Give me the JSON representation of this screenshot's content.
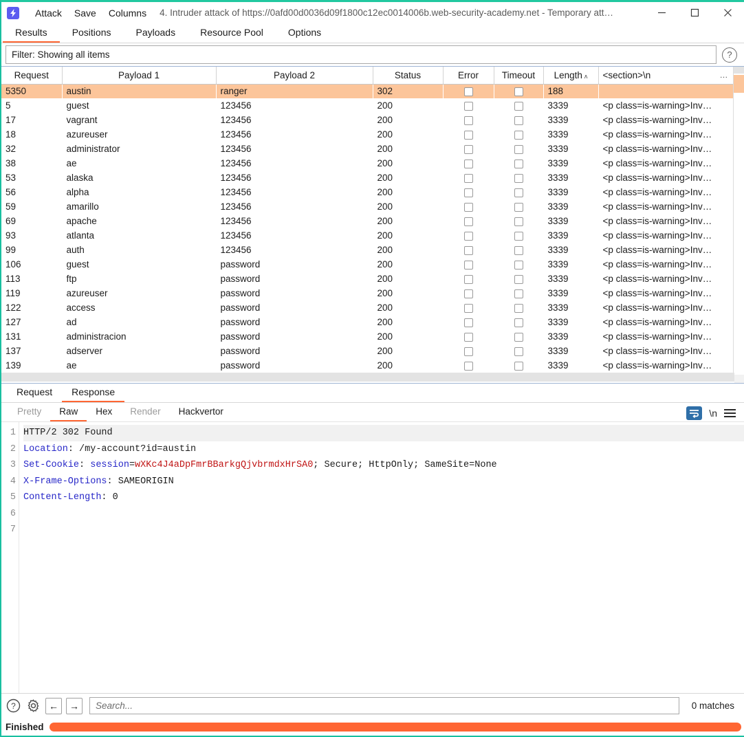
{
  "window": {
    "logo_glyph": "⚡",
    "menus": [
      "Attack",
      "Save",
      "Columns"
    ],
    "title": "4. Intruder attack of https://0afd00d0036d09f1800c12ec0014006b.web-security-academy.net - Temporary att…",
    "buttons": {
      "minimize": "minimize-button",
      "maximize": "maximize-button",
      "close": "close-button"
    }
  },
  "main_tabs": [
    {
      "label": "Results",
      "active": true
    },
    {
      "label": "Positions",
      "active": false
    },
    {
      "label": "Payloads",
      "active": false
    },
    {
      "label": "Resource Pool",
      "active": false
    },
    {
      "label": "Options",
      "active": false
    }
  ],
  "filter": {
    "text": "Filter: Showing all items",
    "help": "?"
  },
  "results_table": {
    "columns": [
      "Request",
      "Payload 1",
      "Payload 2",
      "Status",
      "Error",
      "Timeout",
      "Length",
      "<section>\\n",
      "…"
    ],
    "sorted_column": "Length",
    "sort_arrow": "ʌ",
    "overflow_dots": "…",
    "rows": [
      {
        "request": "5350",
        "payload1": "austin",
        "payload2": "ranger",
        "status": "302",
        "error": false,
        "timeout": false,
        "length": "188",
        "section": "",
        "highlight": true
      },
      {
        "request": "5",
        "payload1": "guest",
        "payload2": "123456",
        "status": "200",
        "error": false,
        "timeout": false,
        "length": "3339",
        "section": "<p class=is-warning>Inv…",
        "highlight": false
      },
      {
        "request": "17",
        "payload1": "vagrant",
        "payload2": "123456",
        "status": "200",
        "error": false,
        "timeout": false,
        "length": "3339",
        "section": "<p class=is-warning>Inv…",
        "highlight": false
      },
      {
        "request": "18",
        "payload1": "azureuser",
        "payload2": "123456",
        "status": "200",
        "error": false,
        "timeout": false,
        "length": "3339",
        "section": "<p class=is-warning>Inv…",
        "highlight": false
      },
      {
        "request": "32",
        "payload1": "administrator",
        "payload2": "123456",
        "status": "200",
        "error": false,
        "timeout": false,
        "length": "3339",
        "section": "<p class=is-warning>Inv…",
        "highlight": false
      },
      {
        "request": "38",
        "payload1": "ae",
        "payload2": "123456",
        "status": "200",
        "error": false,
        "timeout": false,
        "length": "3339",
        "section": "<p class=is-warning>Inv…",
        "highlight": false
      },
      {
        "request": "53",
        "payload1": "alaska",
        "payload2": "123456",
        "status": "200",
        "error": false,
        "timeout": false,
        "length": "3339",
        "section": "<p class=is-warning>Inv…",
        "highlight": false
      },
      {
        "request": "56",
        "payload1": "alpha",
        "payload2": "123456",
        "status": "200",
        "error": false,
        "timeout": false,
        "length": "3339",
        "section": "<p class=is-warning>Inv…",
        "highlight": false
      },
      {
        "request": "59",
        "payload1": "amarillo",
        "payload2": "123456",
        "status": "200",
        "error": false,
        "timeout": false,
        "length": "3339",
        "section": "<p class=is-warning>Inv…",
        "highlight": false
      },
      {
        "request": "69",
        "payload1": "apache",
        "payload2": "123456",
        "status": "200",
        "error": false,
        "timeout": false,
        "length": "3339",
        "section": "<p class=is-warning>Inv…",
        "highlight": false
      },
      {
        "request": "93",
        "payload1": "atlanta",
        "payload2": "123456",
        "status": "200",
        "error": false,
        "timeout": false,
        "length": "3339",
        "section": "<p class=is-warning>Inv…",
        "highlight": false
      },
      {
        "request": "99",
        "payload1": "auth",
        "payload2": "123456",
        "status": "200",
        "error": false,
        "timeout": false,
        "length": "3339",
        "section": "<p class=is-warning>Inv…",
        "highlight": false
      },
      {
        "request": "106",
        "payload1": "guest",
        "payload2": "password",
        "status": "200",
        "error": false,
        "timeout": false,
        "length": "3339",
        "section": "<p class=is-warning>Inv…",
        "highlight": false
      },
      {
        "request": "113",
        "payload1": "ftp",
        "payload2": "password",
        "status": "200",
        "error": false,
        "timeout": false,
        "length": "3339",
        "section": "<p class=is-warning>Inv…",
        "highlight": false
      },
      {
        "request": "119",
        "payload1": "azureuser",
        "payload2": "password",
        "status": "200",
        "error": false,
        "timeout": false,
        "length": "3339",
        "section": "<p class=is-warning>Inv…",
        "highlight": false
      },
      {
        "request": "122",
        "payload1": "access",
        "payload2": "password",
        "status": "200",
        "error": false,
        "timeout": false,
        "length": "3339",
        "section": "<p class=is-warning>Inv…",
        "highlight": false
      },
      {
        "request": "127",
        "payload1": "ad",
        "payload2": "password",
        "status": "200",
        "error": false,
        "timeout": false,
        "length": "3339",
        "section": "<p class=is-warning>Inv…",
        "highlight": false
      },
      {
        "request": "131",
        "payload1": "administracion",
        "payload2": "password",
        "status": "200",
        "error": false,
        "timeout": false,
        "length": "3339",
        "section": "<p class=is-warning>Inv…",
        "highlight": false
      },
      {
        "request": "137",
        "payload1": "adserver",
        "payload2": "password",
        "status": "200",
        "error": false,
        "timeout": false,
        "length": "3339",
        "section": "<p class=is-warning>Inv…",
        "highlight": false
      },
      {
        "request": "139",
        "payload1": "ae",
        "payload2": "password",
        "status": "200",
        "error": false,
        "timeout": false,
        "length": "3339",
        "section": "<p class=is-warning>Inv…",
        "highlight": false
      }
    ]
  },
  "message_tabs": [
    {
      "label": "Request",
      "active": false
    },
    {
      "label": "Response",
      "active": true
    }
  ],
  "view_tabs": [
    {
      "label": "Pretty",
      "active": false,
      "dim": true
    },
    {
      "label": "Raw",
      "active": true,
      "dim": false
    },
    {
      "label": "Hex",
      "active": false,
      "dim": false
    },
    {
      "label": "Render",
      "active": false,
      "dim": true
    },
    {
      "label": "Hackvertor",
      "active": false,
      "dim": false
    }
  ],
  "view_actions": {
    "wrap": "word-wrap-icon",
    "newline": "\\n",
    "menu": "hamburger-menu-icon"
  },
  "response": {
    "line_numbers": [
      "1",
      "2",
      "3",
      "4",
      "5",
      "6",
      "7"
    ],
    "lines": [
      {
        "parts": [
          {
            "t": "HTTP/2 302 Found",
            "c": "plain"
          }
        ]
      },
      {
        "parts": [
          {
            "t": "Location",
            "c": "hdr"
          },
          {
            "t": ": /my-account?id=austin",
            "c": "plain"
          }
        ]
      },
      {
        "parts": [
          {
            "t": "Set-Cookie",
            "c": "hdr"
          },
          {
            "t": ": ",
            "c": "plain"
          },
          {
            "t": "session",
            "c": "hdr"
          },
          {
            "t": "=",
            "c": "plain"
          },
          {
            "t": "wXKc4J4aDpFmrBBarkgQjvbrmdxHrSA0",
            "c": "val"
          },
          {
            "t": "; Secure; HttpOnly; SameSite=None",
            "c": "plain"
          }
        ]
      },
      {
        "parts": [
          {
            "t": "X-Frame-Options",
            "c": "hdr"
          },
          {
            "t": ": SAMEORIGIN",
            "c": "plain"
          }
        ]
      },
      {
        "parts": [
          {
            "t": "Content-Length",
            "c": "hdr"
          },
          {
            "t": ": 0",
            "c": "plain"
          }
        ]
      },
      {
        "parts": []
      },
      {
        "parts": []
      }
    ]
  },
  "bottom": {
    "help": "?",
    "settings": "gear-icon",
    "prev": "←",
    "next": "→",
    "search_placeholder": "Search...",
    "search_value": "",
    "matches": "0 matches"
  },
  "status": {
    "label": "Finished",
    "progress_percent": 100
  },
  "colors": {
    "accent": "#ff6633",
    "highlight_row": "#fcc59a",
    "brand_border": "#19bfa0",
    "header_blue": "#2727c8",
    "cookie_red": "#c01414",
    "wrap_btn": "#2f6fa8"
  }
}
